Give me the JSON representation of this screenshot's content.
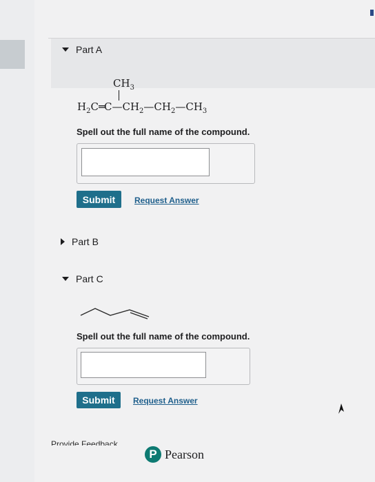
{
  "partA": {
    "title": "Part A",
    "formula": {
      "branch": "CH3",
      "segments": [
        "H2C",
        "=C",
        "—CH2",
        "—CH2",
        "—CH3"
      ]
    },
    "prompt": "Spell out the full name of the compound.",
    "input_value": "",
    "submit_label": "Submit",
    "request_label": "Request Answer"
  },
  "partB": {
    "title": "Part B"
  },
  "partC": {
    "title": "Part C",
    "prompt": "Spell out the full name of the compound.",
    "input_value": "",
    "submit_label": "Submit",
    "request_label": "Request Answer"
  },
  "footer": {
    "feedback_label": "Provide Feedback",
    "brand": "Pearson",
    "brand_initial": "P"
  },
  "colors": {
    "button": "#1f6f8b",
    "link": "#1f5f8c",
    "brand": "#0d7a72"
  }
}
